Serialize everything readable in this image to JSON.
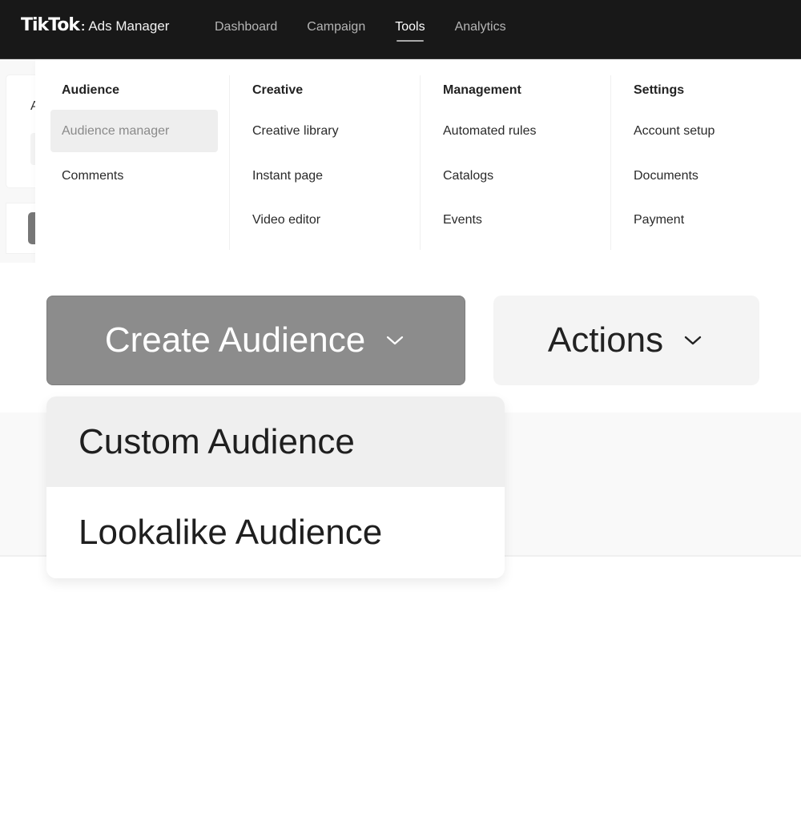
{
  "header": {
    "brand_logo": "TikTok",
    "brand_separator": ":",
    "brand_product": "Ads Manager",
    "nav": [
      {
        "label": "Dashboard",
        "active": false
      },
      {
        "label": "Campaign",
        "active": false
      },
      {
        "label": "Tools",
        "active": true
      },
      {
        "label": "Analytics",
        "active": false
      }
    ]
  },
  "background_page": {
    "card_letter": "A"
  },
  "tools_menu": {
    "columns": [
      {
        "heading": "Audience",
        "items": [
          {
            "label": "Audience manager",
            "selected": true
          },
          {
            "label": "Comments",
            "selected": false
          }
        ]
      },
      {
        "heading": "Creative",
        "items": [
          {
            "label": "Creative library",
            "selected": false
          },
          {
            "label": "Instant page",
            "selected": false
          },
          {
            "label": "Video editor",
            "selected": false
          }
        ]
      },
      {
        "heading": "Management",
        "items": [
          {
            "label": "Automated rules",
            "selected": false
          },
          {
            "label": "Catalogs",
            "selected": false
          },
          {
            "label": "Events",
            "selected": false
          }
        ]
      },
      {
        "heading": "Settings",
        "items": [
          {
            "label": "Account setup",
            "selected": false
          },
          {
            "label": "Documents",
            "selected": false
          },
          {
            "label": "Payment",
            "selected": false
          }
        ]
      }
    ]
  },
  "toolbar": {
    "create_label": "Create Audience",
    "actions_label": "Actions",
    "chevron_icon": "chevron-down-icon"
  },
  "create_dropdown": {
    "options": [
      {
        "label": "Custom Audience",
        "hovered": true
      },
      {
        "label": "Lookalike Audience",
        "hovered": false
      }
    ]
  }
}
